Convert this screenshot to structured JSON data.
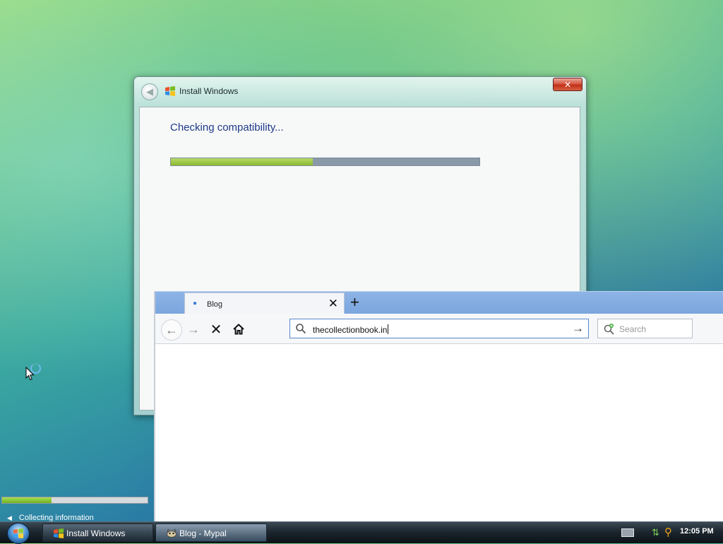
{
  "install_dialog": {
    "title": "Install Windows",
    "close_label": "✕",
    "heading": "Checking compatibility...",
    "progress_fraction": 0.46
  },
  "setup_status": {
    "step_label": "Collecting information",
    "progress_fraction": 0.34
  },
  "browser": {
    "tab": {
      "label": "Blog",
      "close_label": "✕"
    },
    "new_tab_label": "+",
    "url": {
      "value": "thecollectionbook.in"
    },
    "search": {
      "placeholder": "Search"
    }
  },
  "taskbar": {
    "items": [
      {
        "label": "Install Windows"
      },
      {
        "label": "Blog - Mypal"
      }
    ],
    "clock": "12:05 PM"
  },
  "icons": {
    "back": "arrow-left-icon",
    "forward": "arrow-right-icon",
    "stop": "stop-icon",
    "home": "home-icon",
    "go": "go-arrow-icon"
  },
  "colors": {
    "progress_green": "#8cbb2e",
    "progress_track": "#8999a7",
    "heading_blue": "#1e3a8a",
    "close_red": "#d6533c"
  }
}
